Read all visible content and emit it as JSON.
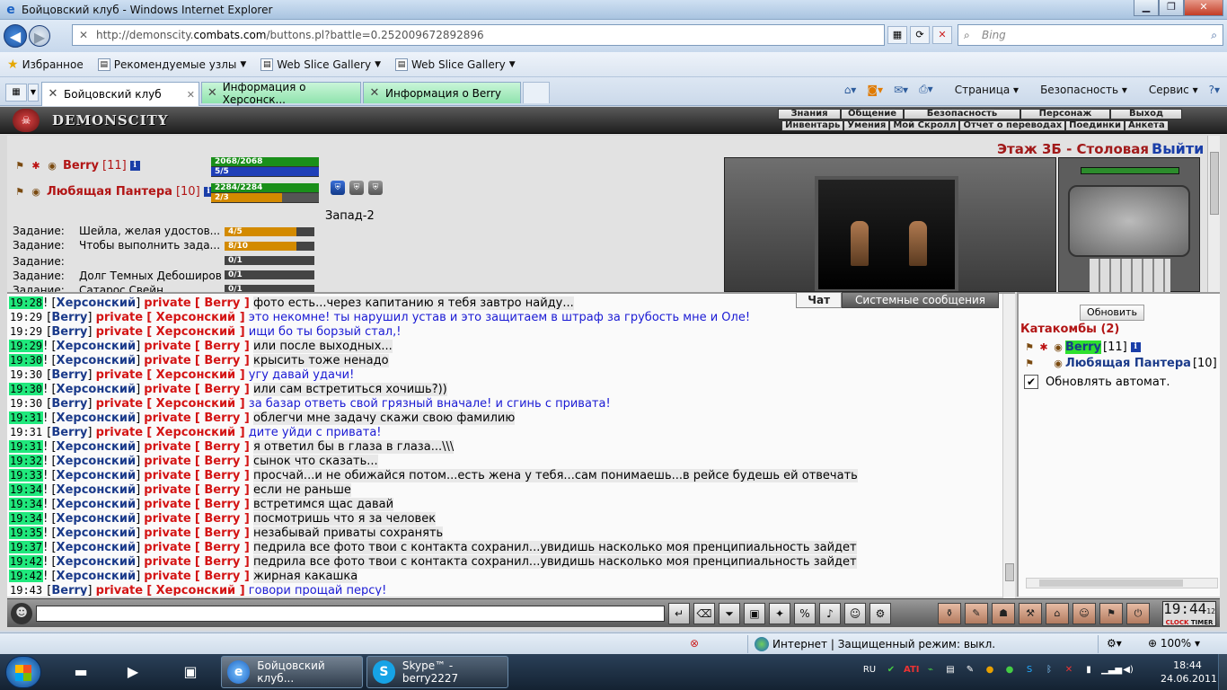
{
  "window": {
    "title": "Бойцовский клуб - Windows Internet Explorer"
  },
  "address": {
    "scheme": "http://demonscity.",
    "host": "combats.com",
    "path": "/buttons.pl?battle=0.252009672892896",
    "search_placeholder": "Bing"
  },
  "favorites": {
    "label": "Избранное",
    "items": [
      "Рекомендуемые узлы",
      "Web Slice Gallery",
      "Web Slice Gallery"
    ]
  },
  "tabs": [
    {
      "label": "Бойцовский клуб"
    },
    {
      "label": "Информация о Херсонск..."
    },
    {
      "label": "Информация о Berry"
    }
  ],
  "commandbar": [
    "Страница",
    "Безопасность",
    "Сервис"
  ],
  "game": {
    "brand": "DEMONSCITY",
    "menu_top": [
      "Знания",
      "Общение",
      "Безопасность",
      "Персонаж",
      "Выход"
    ],
    "menu_bottom": [
      "Инвентарь",
      "Умения",
      "Мой Скролл",
      "Отчет о переводах",
      "Поединки",
      "Анкета"
    ],
    "players": [
      {
        "name": "Berry",
        "level": "[11]",
        "hp": "2068/2068",
        "mp": "5/5"
      },
      {
        "name": "Любящая Пантера",
        "level": "[10]",
        "hp": "2284/2284",
        "mp": "2/3"
      }
    ],
    "location_name": "Запад-2",
    "tasks": [
      {
        "label": "Задание:",
        "text": "Шейла, желая удостов...",
        "progress": "4/5",
        "fraction": 0.8
      },
      {
        "label": "Задание:",
        "text": "Чтобы выполнить зада...",
        "progress": "8/10",
        "fraction": 0.8
      },
      {
        "label": "Задание:",
        "text": "",
        "progress": "0/1",
        "fraction": 0
      },
      {
        "label": "Задание:",
        "text": "Долг Темных Дебоширов",
        "progress": "0/1",
        "fraction": 0
      },
      {
        "label": "Задание:",
        "text": "Сатарос Свейн",
        "progress": "0/1",
        "fraction": 0
      }
    ],
    "floor": "Этаж 3Б - Столовая",
    "exit": "Выйти"
  },
  "chat": {
    "tab_chat": "Чат",
    "tab_system": "Системные сообщения",
    "private_word": "private",
    "messages": [
      {
        "time": "19:28",
        "hl": true,
        "from": "Херсонский",
        "to": "Berry",
        "mine": false,
        "text": "фото есть...через капитанию я тебя завтро найду..."
      },
      {
        "time": "19:29",
        "hl": false,
        "from": "Berry",
        "to": "Херсонский",
        "mine": true,
        "text": "это некомне! ты нарушил устав и это защитаем в штраф за грубость мне и Оле!"
      },
      {
        "time": "19:29",
        "hl": false,
        "from": "Berry",
        "to": "Херсонский",
        "mine": true,
        "text": "ищи бо ты борзый стал,!"
      },
      {
        "time": "19:29",
        "hl": true,
        "from": "Херсонский",
        "to": "Berry",
        "mine": false,
        "text": "или после выходных..."
      },
      {
        "time": "19:30",
        "hl": true,
        "from": "Херсонский",
        "to": "Berry",
        "mine": false,
        "text": "крысить тоже ненадо"
      },
      {
        "time": "19:30",
        "hl": false,
        "from": "Berry",
        "to": "Херсонский",
        "mine": true,
        "text": "угу давай удачи!"
      },
      {
        "time": "19:30",
        "hl": true,
        "from": "Херсонский",
        "to": "Berry",
        "mine": false,
        "text": "или сам встретиться хочишь?))"
      },
      {
        "time": "19:30",
        "hl": false,
        "from": "Berry",
        "to": "Херсонский",
        "mine": true,
        "text": "за базар ответь свой грязный вначале! и сгинь с привата!"
      },
      {
        "time": "19:31",
        "hl": true,
        "from": "Херсонский",
        "to": "Berry",
        "mine": false,
        "text": "облегчи мне задачу скажи свою фамилию"
      },
      {
        "time": "19:31",
        "hl": false,
        "from": "Berry",
        "to": "Херсонский",
        "mine": true,
        "text": "дите уйди с привата!"
      },
      {
        "time": "19:31",
        "hl": true,
        "from": "Херсонский",
        "to": "Berry",
        "mine": false,
        "text": "я ответил бы в глаза в глаза...\\\\\\"
      },
      {
        "time": "19:32",
        "hl": true,
        "from": "Херсонский",
        "to": "Berry",
        "mine": false,
        "text": "сынок что сказать..."
      },
      {
        "time": "19:33",
        "hl": true,
        "from": "Херсонский",
        "to": "Berry",
        "mine": false,
        "text": "просчай...и не обижайся потом...есть жена у тебя...сам понимаешь...в рейсе будешь ей отвечать"
      },
      {
        "time": "19:34",
        "hl": true,
        "from": "Херсонский",
        "to": "Berry",
        "mine": false,
        "text": "если не раньше"
      },
      {
        "time": "19:34",
        "hl": true,
        "from": "Херсонский",
        "to": "Berry",
        "mine": false,
        "text": "встретимся щас давай"
      },
      {
        "time": "19:34",
        "hl": true,
        "from": "Херсонский",
        "to": "Berry",
        "mine": false,
        "text": "посмотришь что я за человек"
      },
      {
        "time": "19:35",
        "hl": true,
        "from": "Херсонский",
        "to": "Berry",
        "mine": false,
        "text": "незабывай приваты сохранять"
      },
      {
        "time": "19:37",
        "hl": true,
        "from": "Херсонский",
        "to": "Berry",
        "mine": false,
        "text": "педрила все фото твои с контакта сохранил...увидишь насколько моя пренципиальность зайдет"
      },
      {
        "time": "19:42",
        "hl": true,
        "from": "Херсонский",
        "to": "Berry",
        "mine": false,
        "text": "педрила все фото твои с контакта сохранил...увидишь насколько моя пренципиальность зайдет"
      },
      {
        "time": "19:42",
        "hl": true,
        "from": "Херсонский",
        "to": "Berry",
        "mine": false,
        "text": "жирная какашка"
      },
      {
        "time": "19:43",
        "hl": false,
        "from": "Berry",
        "to": "Херсонский",
        "mine": true,
        "text": "говори прощай персу!"
      }
    ]
  },
  "room": {
    "refresh": "Обновить",
    "title": "Катакомбы (2)",
    "users": [
      {
        "name": "Berry",
        "level": "[11]",
        "me": true
      },
      {
        "name": "Любящая Пантера",
        "level": "[10]",
        "me": false
      }
    ],
    "auto_refresh": "Обновлять автомат."
  },
  "clock": {
    "time": "19:44",
    "sec": "12",
    "label_a": "CLOCK",
    "label_b": "TIMER"
  },
  "status": {
    "zone": "Интернет | Защищенный режим: выкл.",
    "zoom": "100%"
  },
  "taskbar": {
    "tasks": [
      "Бойцовский клуб...",
      "Skype™ - berry2227"
    ],
    "lang": "RU",
    "time": "18:44",
    "date": "24.06.2011"
  }
}
